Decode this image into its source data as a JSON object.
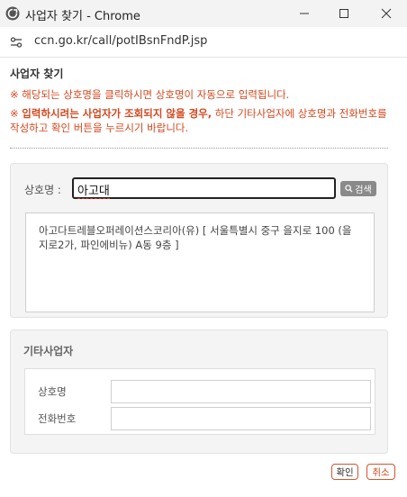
{
  "window": {
    "title": "사업자 찾기 - Chrome",
    "url": "ccn.go.kr/call/potIBsnFndP.jsp"
  },
  "page": {
    "heading": "사업자 찾기",
    "notice1": "※ 해당되는 상호명을 클릭하시면 상호명이 자동으로 입력됩니다.",
    "notice2_prefix": "※ ",
    "notice2_bold": "입력하시려는 사업자가 조회되지 않을 경우,",
    "notice2_rest": " 하단 기타사업자에 상호명과 전화번호를 작성하고 확인 버튼을 누르시기 바랍니다."
  },
  "search": {
    "label": "상호명 :",
    "value": "아고대",
    "button_label": "검색",
    "result": "아고다트레블오퍼레이션스코리아(유) [ 서울특별시 중구 을지로 100 (을지로2가, 파인에비뉴) A동 9층 ]"
  },
  "other_business": {
    "title": "기타사업자",
    "name_label": "상호명",
    "name_value": "",
    "phone_label": "전화번호",
    "phone_value": ""
  },
  "actions": {
    "ok_label": "확인",
    "cancel_label": "취소"
  }
}
